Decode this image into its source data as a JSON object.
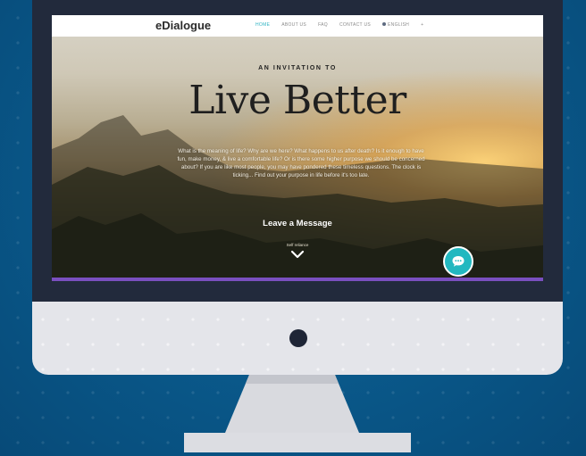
{
  "site": {
    "brand": "eDialogue",
    "nav": {
      "items": [
        "HOME",
        "ABOUT US",
        "FAQ",
        "CONTACT US",
        "ENGLISH",
        "+"
      ],
      "active_index": 0
    }
  },
  "hero": {
    "eyebrow": "AN INVITATION TO",
    "headline": "Live Better",
    "body": "What is the meaning of life? Why are we here? What happens to us after death? Is it enough to have fun, make money, & live a comfortable life? Or is there some higher purpose we should be concerned about? If you are like most people, you may have pondered these timeless questions. The clock is ticking... Find out your purpose in life before it's too late.",
    "cta_label": "Leave a Message",
    "small_label": "Self reliance"
  },
  "icons": {
    "power": "power-dot-icon",
    "chat": "chat-bubble-icon",
    "scroll": "chevron-down-icon",
    "language": "flag-icon"
  },
  "colors": {
    "background": "#0a5a8c",
    "bezel": "#222a3c",
    "chin": "#e4e5ea",
    "accent_teal": "#22b8c0",
    "accent_purple": "#7a4fbf"
  }
}
